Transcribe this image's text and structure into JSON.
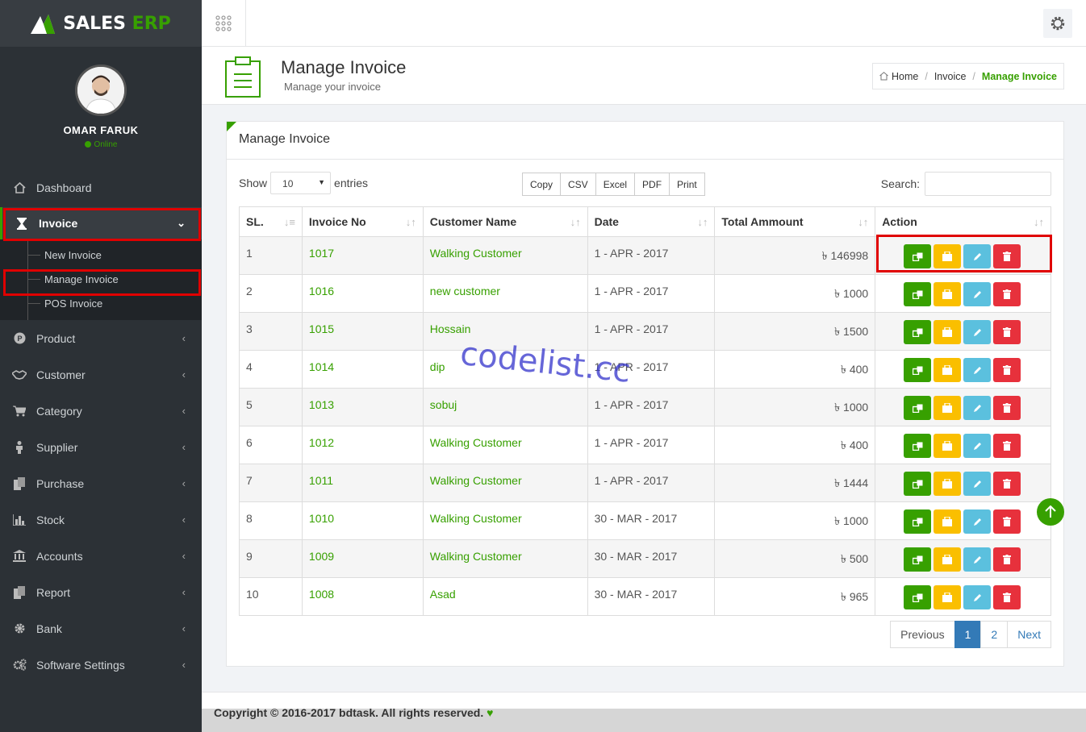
{
  "brand": {
    "name_part1": "SALES",
    "name_part2": "ERP",
    "accent": "#37a000"
  },
  "user": {
    "name": "OMAR FARUK",
    "status": "Online"
  },
  "sidebar": {
    "items": [
      {
        "label": "Dashboard",
        "icon": "home-icon"
      },
      {
        "label": "Invoice",
        "icon": "hourglass-icon"
      },
      {
        "label": "Product",
        "icon": "product-icon"
      },
      {
        "label": "Customer",
        "icon": "handshake-icon"
      },
      {
        "label": "Category",
        "icon": "cart-icon"
      },
      {
        "label": "Supplier",
        "icon": "person-icon"
      },
      {
        "label": "Purchase",
        "icon": "files-icon"
      },
      {
        "label": "Stock",
        "icon": "bar-chart-icon"
      },
      {
        "label": "Accounts",
        "icon": "bank-icon"
      },
      {
        "label": "Report",
        "icon": "files-icon"
      },
      {
        "label": "Bank",
        "icon": "gear-icon"
      },
      {
        "label": "Software Settings",
        "icon": "gears-icon"
      }
    ],
    "invoice_sub": [
      "New Invoice",
      "Manage Invoice",
      "POS Invoice"
    ]
  },
  "header": {
    "title": "Manage Invoice",
    "subtitle": "Manage your invoice"
  },
  "breadcrumb": {
    "home": "Home",
    "mid": "Invoice",
    "current": "Manage Invoice"
  },
  "panel": {
    "title": "Manage Invoice"
  },
  "controls": {
    "show": "Show",
    "entries": "entries",
    "page_size": "10",
    "buttons": [
      "Copy",
      "CSV",
      "Excel",
      "PDF",
      "Print"
    ],
    "search_label": "Search:"
  },
  "table": {
    "headers": [
      "SL.",
      "Invoice No",
      "Customer Name",
      "Date",
      "Total Ammount",
      "Action"
    ],
    "rows": [
      {
        "sl": "1",
        "no": "1017",
        "customer": "Walking Customer",
        "date": "1 - APR - 2017",
        "amount": "৳ 146998"
      },
      {
        "sl": "2",
        "no": "1016",
        "customer": "new customer",
        "date": "1 - APR - 2017",
        "amount": "৳ 1000"
      },
      {
        "sl": "3",
        "no": "1015",
        "customer": "Hossain",
        "date": "1 - APR - 2017",
        "amount": "৳ 1500"
      },
      {
        "sl": "4",
        "no": "1014",
        "customer": "dip",
        "date": "1 - APR - 2017",
        "amount": "৳ 400"
      },
      {
        "sl": "5",
        "no": "1013",
        "customer": "sobuj",
        "date": "1 - APR - 2017",
        "amount": "৳ 1000"
      },
      {
        "sl": "6",
        "no": "1012",
        "customer": "Walking Customer",
        "date": "1 - APR - 2017",
        "amount": "৳ 400"
      },
      {
        "sl": "7",
        "no": "1011",
        "customer": "Walking Customer",
        "date": "1 - APR - 2017",
        "amount": "৳ 1444"
      },
      {
        "sl": "8",
        "no": "1010",
        "customer": "Walking Customer",
        "date": "30 - MAR - 2017",
        "amount": "৳ 1000"
      },
      {
        "sl": "9",
        "no": "1009",
        "customer": "Walking Customer",
        "date": "30 - MAR - 2017",
        "amount": "৳ 500"
      },
      {
        "sl": "10",
        "no": "1008",
        "customer": "Asad",
        "date": "30 - MAR - 2017",
        "amount": "৳ 965"
      }
    ]
  },
  "pagination": {
    "previous": "Previous",
    "pages": [
      "1",
      "2"
    ],
    "next": "Next"
  },
  "watermark": "codelist.cc",
  "footer": {
    "text": "Copyright © 2016-2017 bdtask. All rights reserved."
  }
}
